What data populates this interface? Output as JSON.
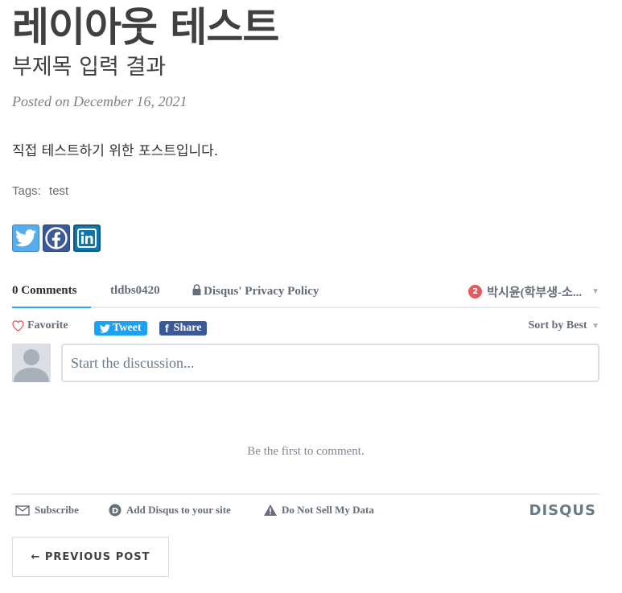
{
  "post": {
    "title": "레이아웃 테스트",
    "subtitle": "부제목 입력 결과",
    "meta": "Posted on December 16, 2021",
    "body": "직접 테스트하기 위한 포스트입니다.",
    "tags_label": "Tags:",
    "tags": [
      "test"
    ]
  },
  "share": {
    "icons": [
      "twitter-icon",
      "facebook-icon",
      "linkedin-icon"
    ]
  },
  "disqus": {
    "tabs": {
      "comments": "0 Comments",
      "community": "tldbs0420",
      "privacy": "Disqus' Privacy Policy"
    },
    "user": {
      "notifications": "2",
      "name": "박시윤(학부생-소..."
    },
    "actions": {
      "favorite": "Favorite",
      "tweet": "Tweet",
      "share": "Share",
      "sort": "Sort by Best"
    },
    "composer": {
      "placeholder": "Start the discussion..."
    },
    "empty": "Be the first to comment.",
    "footer": {
      "subscribe": "Subscribe",
      "add": "Add Disqus to your site",
      "dnsmpi": "Do Not Sell My Data",
      "brand": "DISQUS"
    },
    "colors": {
      "accent": "#2e9fff",
      "tweet": "#1da1f2",
      "facebook": "#3b5998",
      "notification": "#e65c5c"
    }
  },
  "pager": {
    "previous": "← PREVIOUS POST"
  }
}
